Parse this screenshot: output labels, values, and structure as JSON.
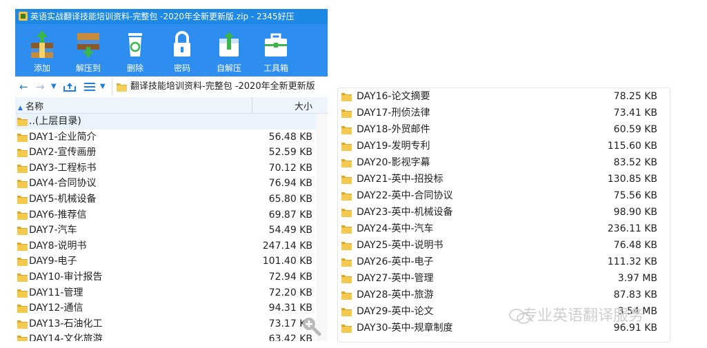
{
  "window": {
    "title": "英语实战翻译技能培训资料-完整包 -2020年全新更新版.zip - 2345好压"
  },
  "toolbar": {
    "buttons": [
      {
        "label": "添加",
        "icon": "add-archive-icon"
      },
      {
        "label": "解压到",
        "icon": "extract-to-icon"
      },
      {
        "label": "删除",
        "icon": "delete-icon"
      },
      {
        "label": "密码",
        "icon": "lock-icon"
      },
      {
        "label": "自解压",
        "icon": "self-extract-icon"
      },
      {
        "label": "工具箱",
        "icon": "toolbox-icon"
      }
    ]
  },
  "address_bar": {
    "path": "翻译技能培训资料-完整包 -2020年全新更新版"
  },
  "columns": {
    "name": "名称",
    "size": "大小"
  },
  "parent_row": {
    "name": "..(上层目录)"
  },
  "files_left": [
    {
      "name": "DAY1-企业简介",
      "size": "56.48 KB"
    },
    {
      "name": "DAY2-宣传画册",
      "size": "52.59 KB"
    },
    {
      "name": "DAY3-工程标书",
      "size": "70.12 KB"
    },
    {
      "name": "DAY4-合同协议",
      "size": "76.94 KB"
    },
    {
      "name": "DAY5-机械设备",
      "size": "65.80 KB"
    },
    {
      "name": "DAY6-推荐信",
      "size": "69.87 KB"
    },
    {
      "name": "DAY7-汽车",
      "size": "54.49 KB"
    },
    {
      "name": "DAY8-说明书",
      "size": "247.14 KB"
    },
    {
      "name": "DAY9-电子",
      "size": "101.40 KB"
    },
    {
      "name": "DAY10-审计报告",
      "size": "72.94 KB"
    },
    {
      "name": "DAY11-管理",
      "size": "72.20 KB"
    },
    {
      "name": "DAY12-通信",
      "size": "94.31 KB"
    },
    {
      "name": "DAY13-石油化工",
      "size": "73.17 KB"
    },
    {
      "name": "DAY14-文化旅游",
      "size": "63.42 KB"
    }
  ],
  "files_right": [
    {
      "name": "DAY16-论文摘要",
      "size": "78.25 KB"
    },
    {
      "name": "DAY17-刑侦法律",
      "size": "73.41 KB"
    },
    {
      "name": "DAY18-外贸邮件",
      "size": "60.59 KB"
    },
    {
      "name": "DAY19-发明专利",
      "size": "115.60 KB"
    },
    {
      "name": "DAY20-影视字幕",
      "size": "83.52 KB"
    },
    {
      "name": "DAY21-英中-招投标",
      "size": "130.85 KB"
    },
    {
      "name": "DAY22-英中-合同协议",
      "size": "75.56 KB"
    },
    {
      "name": "DAY23-英中-机械设备",
      "size": "98.90 KB"
    },
    {
      "name": "DAY24-英中-汽车",
      "size": "236.11 KB"
    },
    {
      "name": "DAY25-英中-说明书",
      "size": "76.48 KB"
    },
    {
      "name": "DAY26-英中-电子",
      "size": "111.32 KB"
    },
    {
      "name": "DAY27-英中-管理",
      "size": "3.97 MB"
    },
    {
      "name": "DAY28-英中-旅游",
      "size": "87.83 KB"
    },
    {
      "name": "DAY29-英中-论文",
      "size": "3.54 MB"
    },
    {
      "name": "DAY30-英中-规章制度",
      "size": "96.91 KB"
    }
  ],
  "watermark": {
    "text": "专业英语翻译服务"
  },
  "colors": {
    "toolbar_blue": "#2d8ef0",
    "titlebar_blue": "#1e88e5",
    "folder_yellow": "#e8b23a"
  }
}
